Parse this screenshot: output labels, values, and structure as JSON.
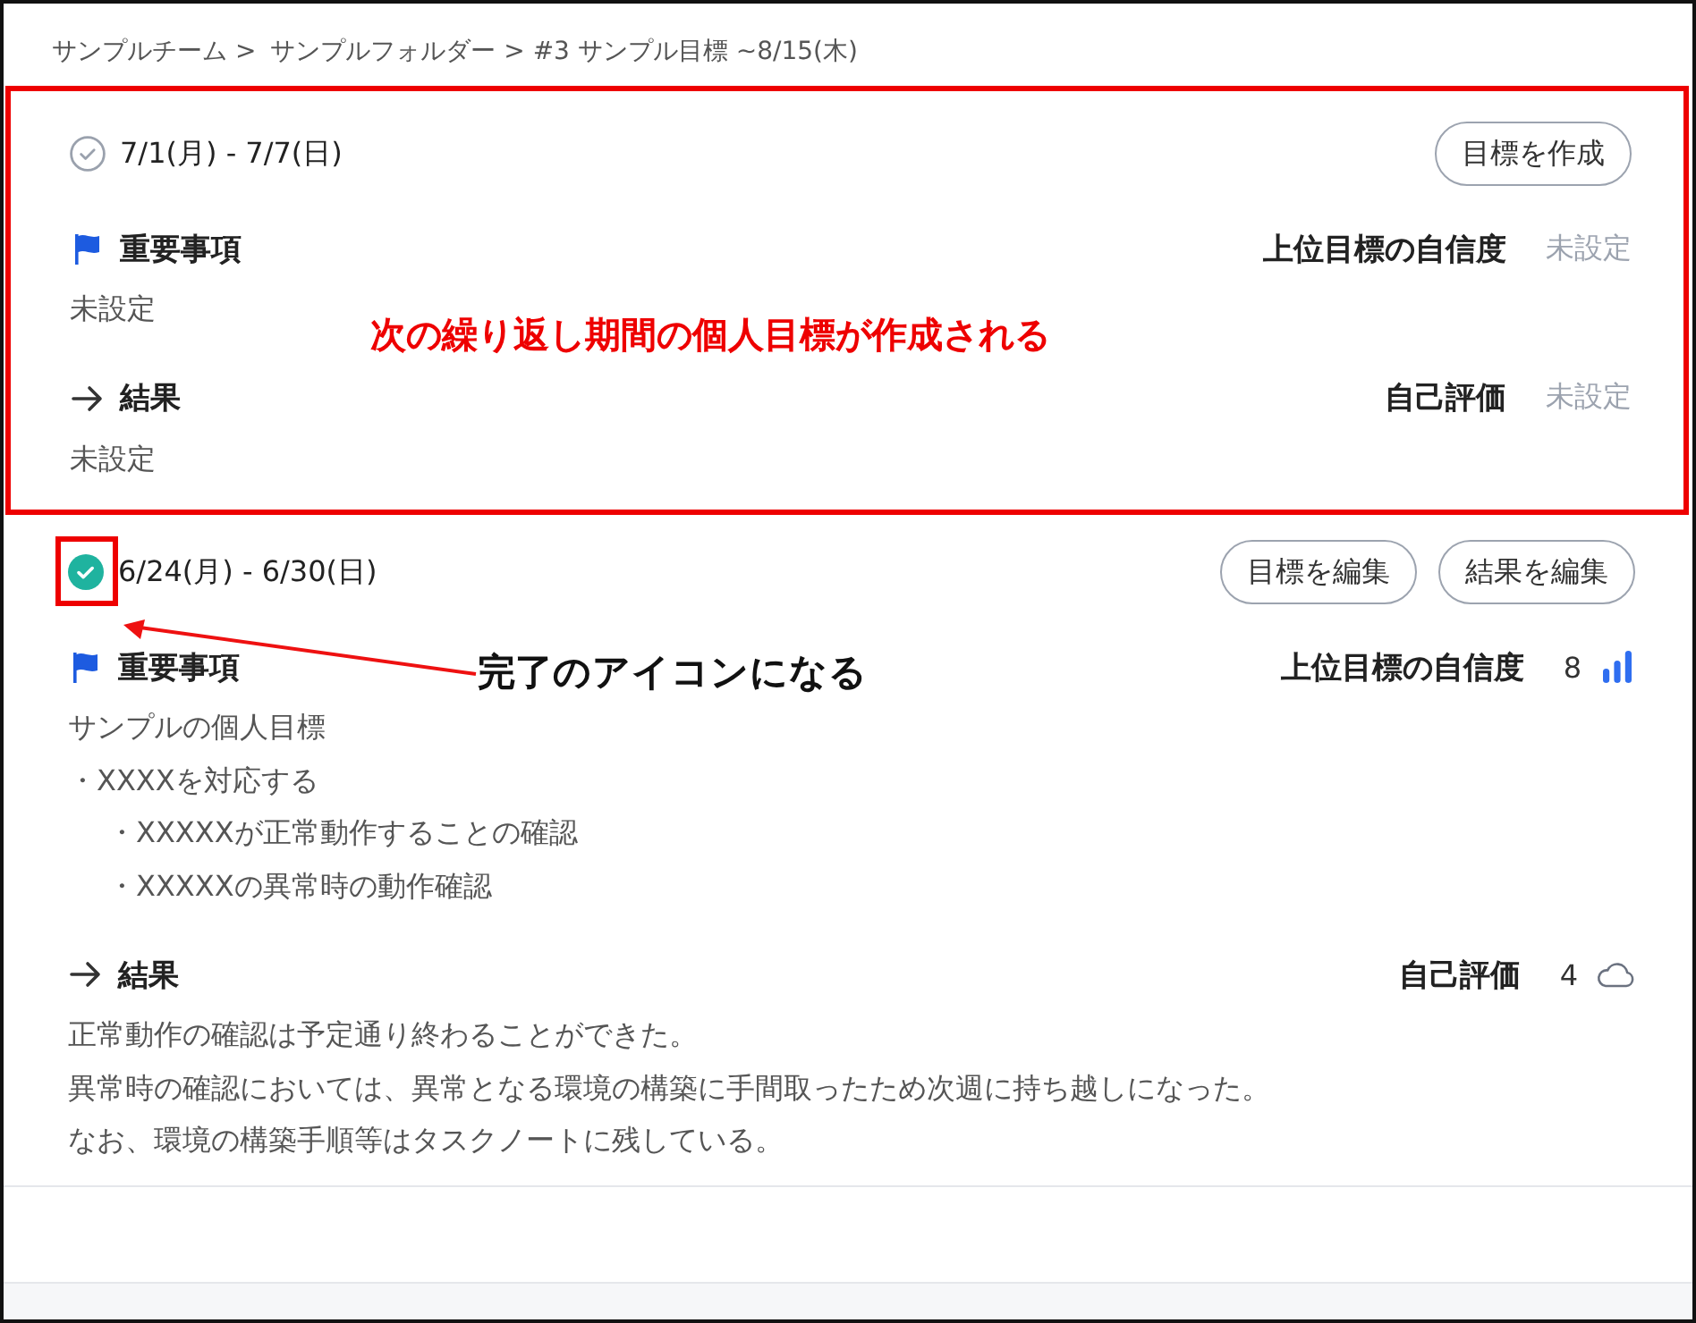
{
  "breadcrumb": [
    {
      "text": "サンプルチーム >"
    },
    {
      "text": "サンプルフォルダー > #3 サンプル目標 ~8/15(木)"
    }
  ],
  "periods": [
    {
      "range": "7/1(月) - 7/7(日)",
      "completed": false,
      "highlighted": true,
      "icon_highlighted": false,
      "buttons": [
        "目標を作成"
      ],
      "sections": [
        {
          "kind": "priority",
          "heading": "重要事項",
          "metric": {
            "kind": "confidence",
            "label": "上位目標の自信度",
            "value": "未設定",
            "set": false
          },
          "body": [
            {
              "text": "未設定"
            }
          ]
        },
        {
          "kind": "result",
          "heading": "結果",
          "metric": {
            "kind": "self_rating",
            "label": "自己評価",
            "value": "未設定",
            "set": false
          },
          "body": [
            {
              "text": "未設定"
            }
          ]
        }
      ]
    },
    {
      "range": "6/24(月) - 6/30(日)",
      "completed": true,
      "highlighted": false,
      "icon_highlighted": true,
      "buttons": [
        "目標を編集",
        "結果を編集"
      ],
      "sections": [
        {
          "kind": "priority",
          "heading": "重要事項",
          "metric": {
            "kind": "confidence",
            "label": "上位目標の自信度",
            "value": "8",
            "set": true
          },
          "body": [
            {
              "text": "サンプルの個人目標"
            },
            {
              "text": "・XXXXを対応する",
              "children": [
                {
                  "text": "・XXXXXが正常動作することの確認"
                },
                {
                  "text": "・XXXXXの異常時の動作確認"
                }
              ]
            }
          ]
        },
        {
          "kind": "result",
          "heading": "結果",
          "metric": {
            "kind": "self_rating",
            "label": "自己評価",
            "value": "4",
            "set": true
          },
          "body": [
            {
              "text": "正常動作の確認は予定通り終わることができた。"
            },
            {
              "text": "異常時の確認においては、異常となる環境の構築に手間取ったため次週に持ち越しになった。"
            },
            {
              "text": "なお、環境の構築手順等はタスクノートに残している。"
            }
          ]
        }
      ]
    }
  ],
  "annotations": [
    {
      "kind": "note",
      "text": "次の繰り返し期間の個人目標が作成される"
    },
    {
      "kind": "callout",
      "text": "完了のアイコンになる"
    }
  ]
}
